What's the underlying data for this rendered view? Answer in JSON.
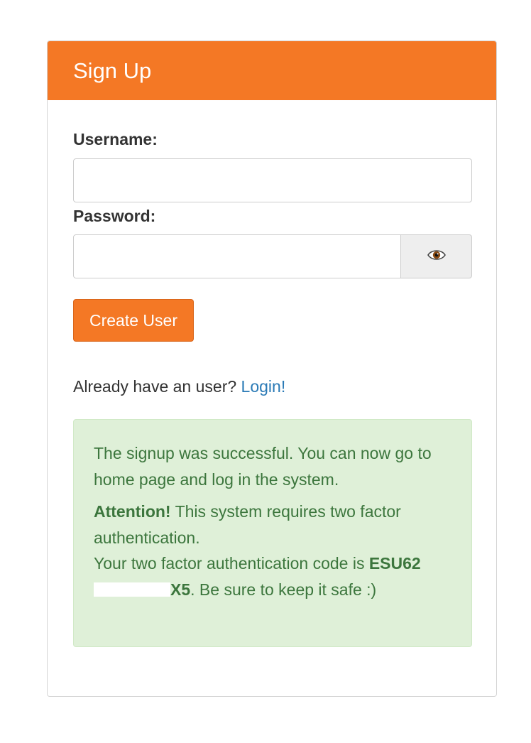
{
  "header": {
    "title": "Sign Up"
  },
  "form": {
    "username_label": "Username:",
    "username_value": "",
    "password_label": "Password:",
    "password_value": "",
    "toggle_icon": "eye-icon",
    "toggle_glyph": "👁",
    "submit_label": "Create User"
  },
  "login_prompt": {
    "text": "Already have an user?",
    "link_label": "Login!"
  },
  "alert": {
    "success_message": "The signup was successful. You can now go to home page and log in the system.",
    "attention_label": "Attention!",
    "attention_text": "This system requires two factor authentication.",
    "code_intro": "Your two factor authentication code is",
    "code_prefix": "ESU62",
    "code_suffix": "X5",
    "code_outro": ". Be sure to keep it safe :)"
  },
  "colors": {
    "brand": "#f47825",
    "link": "#2a7ab6",
    "success_bg": "#dff0d8",
    "success_text": "#3c763d"
  }
}
